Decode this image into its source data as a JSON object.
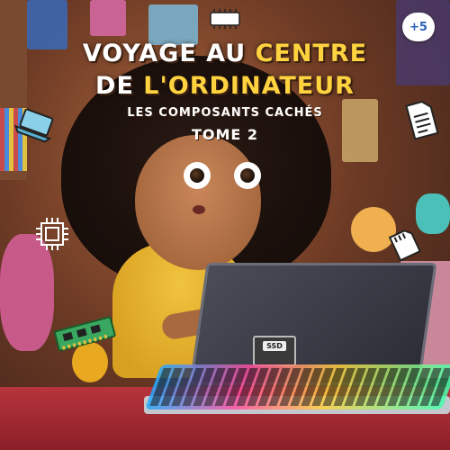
{
  "cover": {
    "title_line1_part1": "VOYAGE AU",
    "title_line1_part2": "CENTRE",
    "title_line2_part1": "DE",
    "title_line2_part2": "L'ORDINATEUR",
    "subtitle": "LES COMPOSANTS CACHÉS",
    "volume": "TOME 2"
  },
  "badge": {
    "label": "+5"
  },
  "ssd": {
    "label": "SSD"
  },
  "colors": {
    "title_white": "#ffffff",
    "title_yellow": "#ffd23f",
    "badge_text": "#2b5fb8"
  },
  "icons": [
    "chip-icon",
    "laptop-icon",
    "processor-icon",
    "document-icon",
    "sd-card-icon",
    "circuit-board-icon",
    "ssd-icon"
  ]
}
